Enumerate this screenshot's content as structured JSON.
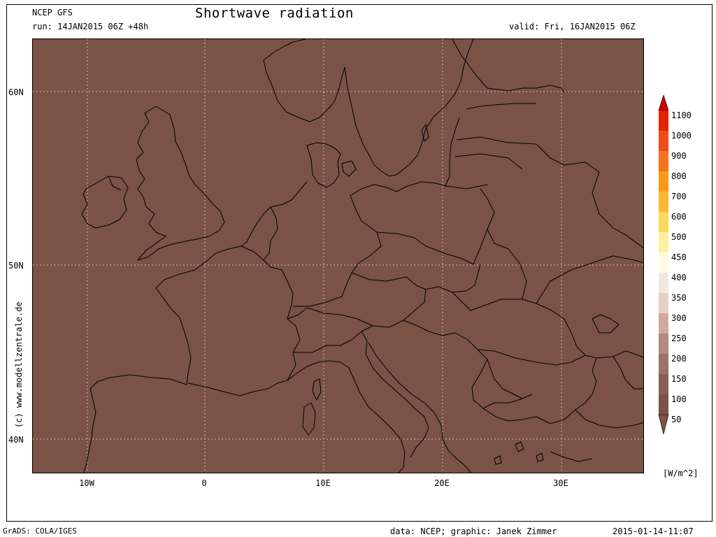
{
  "header": {
    "source": "NCEP GFS",
    "run": "run: 14JAN2015 06Z +48h",
    "title": "Shortwave radiation",
    "valid": "valid: Fri, 16JAN2015 06Z"
  },
  "map": {
    "fill_color": "#7a5246",
    "lat_labels": [
      "60N",
      "50N",
      "40N"
    ],
    "lon_labels": [
      "10W",
      "0",
      "10E",
      "20E",
      "30E"
    ],
    "watermark": "(c)  www.modellzentrale.de"
  },
  "legend": {
    "unit": "[W/m^2]",
    "levels": [
      "1100",
      "1000",
      "900",
      "800",
      "700",
      "600",
      "500",
      "450",
      "400",
      "350",
      "300",
      "250",
      "200",
      "150",
      "100",
      "50"
    ],
    "colors": [
      "#cc0000",
      "#e62200",
      "#f24a1a",
      "#f8731f",
      "#fb9b15",
      "#fbb832",
      "#fcd85c",
      "#fdf0a0",
      "#fdfbe2",
      "#f2e8e2",
      "#e6d0c7",
      "#cfaa9b",
      "#b38a7b",
      "#9c7364",
      "#876053",
      "#7a5246"
    ]
  },
  "footer": {
    "left": "GrADS: COLA/IGES",
    "center": "data: NCEP; graphic: Janek Zimmer",
    "right": "2015-01-14-11:07"
  }
}
